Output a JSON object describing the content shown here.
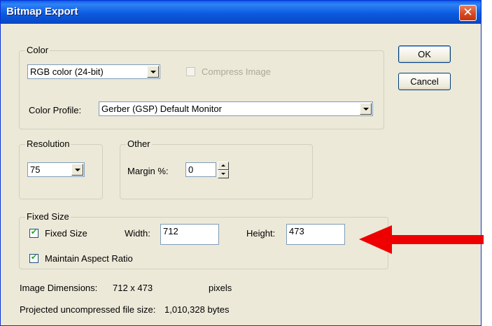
{
  "window": {
    "title": "Bitmap Export"
  },
  "buttons": {
    "ok": "OK",
    "cancel": "Cancel"
  },
  "color_group": {
    "legend": "Color",
    "color_mode_value": "RGB color (24-bit)",
    "compress_label": "Compress Image",
    "compress_checked": false,
    "profile_label": "Color Profile:",
    "profile_value": "Gerber (GSP) Default Monitor"
  },
  "resolution_group": {
    "legend": "Resolution",
    "value": "75"
  },
  "other_group": {
    "legend": "Other",
    "margin_label": "Margin %:",
    "margin_value": "0"
  },
  "fixed_size_group": {
    "legend": "Fixed Size",
    "fixed_size_label": "Fixed Size",
    "fixed_size_checked": true,
    "width_label": "Width:",
    "width_value": "712",
    "height_label": "Height:",
    "height_value": "473",
    "aspect_label": "Maintain Aspect Ratio",
    "aspect_checked": true
  },
  "info": {
    "dimensions_label": "Image Dimensions:",
    "dimensions_value": "712 x 473",
    "dimensions_unit": "pixels",
    "filesize_label": "Projected uncompressed file size:",
    "filesize_value": "1,010,328 bytes"
  },
  "annotation": {
    "arrow_color": "#ee0000"
  }
}
